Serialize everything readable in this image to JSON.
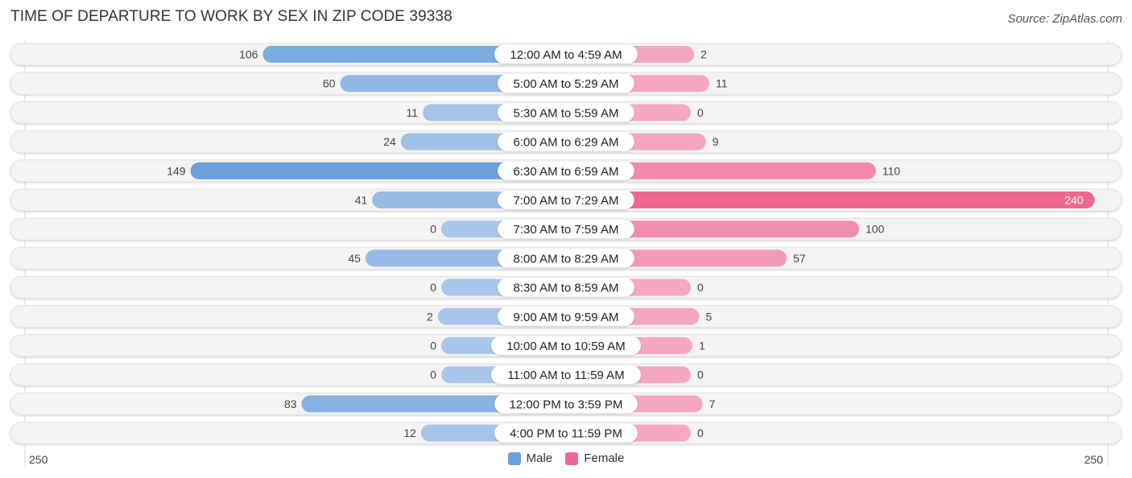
{
  "header": {
    "title": "TIME OF DEPARTURE TO WORK BY SEX IN ZIP CODE 39338",
    "source": "Source: ZipAtlas.com"
  },
  "colors": {
    "male": "#6a9fda",
    "male_light": "#a9c7eb",
    "female": "#f06792",
    "female_light": "#f5a8c0",
    "row_bg": "#f2f2f2"
  },
  "legend": {
    "male_label": "Male",
    "female_label": "Female"
  },
  "axis": {
    "left_label": "250",
    "right_label": "250"
  },
  "chart_data": {
    "type": "bar",
    "orientation": "horizontal-diverging",
    "title": "TIME OF DEPARTURE TO WORK BY SEX IN ZIP CODE 39338",
    "xlabel": "",
    "ylabel": "",
    "xlim": [
      -250,
      250
    ],
    "legend_position": "bottom-center",
    "categories": [
      "12:00 AM to 4:59 AM",
      "5:00 AM to 5:29 AM",
      "5:30 AM to 5:59 AM",
      "6:00 AM to 6:29 AM",
      "6:30 AM to 6:59 AM",
      "7:00 AM to 7:29 AM",
      "7:30 AM to 7:59 AM",
      "8:00 AM to 8:29 AM",
      "8:30 AM to 8:59 AM",
      "9:00 AM to 9:59 AM",
      "10:00 AM to 10:59 AM",
      "11:00 AM to 11:59 AM",
      "12:00 PM to 3:59 PM",
      "4:00 PM to 11:59 PM"
    ],
    "series": [
      {
        "name": "Male",
        "values": [
          106,
          60,
          11,
          24,
          149,
          41,
          0,
          45,
          0,
          2,
          0,
          0,
          83,
          12
        ]
      },
      {
        "name": "Female",
        "values": [
          2,
          11,
          0,
          9,
          110,
          240,
          100,
          57,
          0,
          5,
          1,
          0,
          7,
          0
        ]
      }
    ]
  }
}
